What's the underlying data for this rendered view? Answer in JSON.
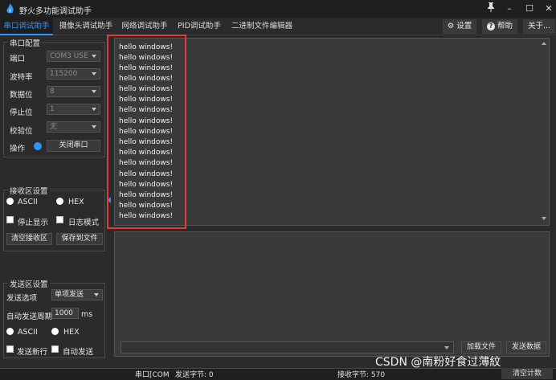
{
  "app": {
    "title": "野火多功能调试助手",
    "accent": "#2f94ff"
  },
  "window_controls": {
    "pin": "📌",
    "minimize": "–",
    "maximize": "☐",
    "close": "✕"
  },
  "tabs": [
    "串口调试助手",
    "摄像头调试助手",
    "网络调试助手",
    "PID调试助手",
    "二进制文件编辑器"
  ],
  "toolbar": {
    "settings": "设置",
    "help": "帮助",
    "about": "关于..."
  },
  "serial_config": {
    "title": "串口配置",
    "port_label": "端口",
    "port_value": "COM3 USE",
    "baud_label": "波特率",
    "baud_value": "115200",
    "databits_label": "数据位",
    "databits_value": "8",
    "stopbits_label": "停止位",
    "stopbits_value": "1",
    "parity_label": "校验位",
    "parity_value": "无",
    "op_label": "操作",
    "close_port": "关闭串口"
  },
  "receive_settings": {
    "title": "接收区设置",
    "ascii": "ASCII",
    "hex": "HEX",
    "stop_display": "停止显示",
    "log_mode": "日志模式",
    "clear": "清空接收区",
    "save": "保存到文件"
  },
  "send_settings": {
    "title": "发送区设置",
    "option_label": "发送选项",
    "option_value": "单项发送",
    "period_label": "自动发送周期",
    "period_value": "1000",
    "period_unit": "ms",
    "ascii": "ASCII",
    "hex": "HEX",
    "newline": "发送新行",
    "auto_send": "自动发送"
  },
  "receive_lines": [
    "hello windows!",
    "hello windows!",
    "hello windows!",
    "hello windows!",
    "hello windows!",
    "hello windows!",
    "hello windows!",
    "hello windows!",
    "hello windows!",
    "hello windows!",
    "hello windows!",
    "hello windows!",
    "hello windows!",
    "hello windows!",
    "hello windows!",
    "hello windows!",
    "hello windows!"
  ],
  "send_area": {
    "load_file": "加载文件",
    "send_data": "发送数据"
  },
  "status_bar": {
    "port": "串口[COM",
    "sent": "发送字节: 0",
    "received": "接收字节: 570",
    "clear_count": "清空计数"
  },
  "watermark": "CSDN @南粉好食过薄紋"
}
